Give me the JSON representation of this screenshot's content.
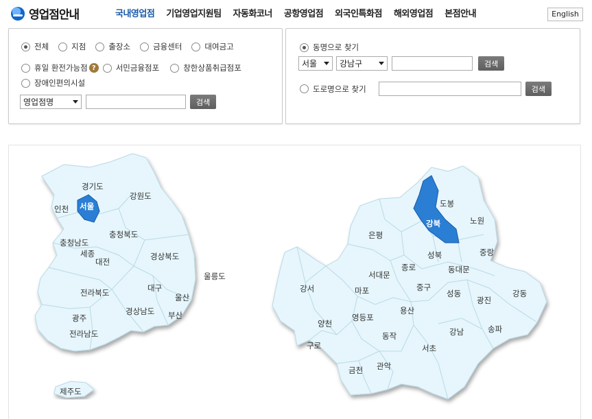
{
  "header": {
    "logo_text": "영업점안내",
    "nav": [
      "국내영업점",
      "기업영업지원팀",
      "자동화코너",
      "공항영업점",
      "외국인특화점",
      "해외영업점",
      "본점안내"
    ],
    "lang_button": "English"
  },
  "left_panel": {
    "type_options": [
      "전체",
      "지점",
      "출장소",
      "금융센터",
      "대여금고"
    ],
    "type_options_row2": [
      "휴일 환전가능점",
      "서민금융점포",
      "창한상품취급점포"
    ],
    "type_options_row3": [
      "장애인편의시설"
    ],
    "selected_type": "전체",
    "search_select": "영업점명",
    "search_button": "검색"
  },
  "right_panel": {
    "dong_label": "동명으로 찾기",
    "city_select": "서울",
    "district_select": "강남구",
    "dong_button": "검색",
    "road_label": "도로명으로 찾기",
    "road_button": "검색"
  },
  "korea_map": {
    "selected": "서울",
    "regions": [
      "경기도",
      "인천",
      "서울",
      "강원도",
      "충청북도",
      "충청남도",
      "세종",
      "대전",
      "경상북도",
      "울릉도",
      "전라북도",
      "대구",
      "울산",
      "광주",
      "경상남도",
      "부산",
      "전라남도",
      "제주도"
    ]
  },
  "seoul_map": {
    "selected": "강북",
    "districts": [
      "도봉",
      "강북",
      "노원",
      "은평",
      "성북",
      "중랑",
      "종로",
      "동대문",
      "서대문",
      "강서",
      "마포",
      "중구",
      "성동",
      "광진",
      "강동",
      "용산",
      "양천",
      "영등포",
      "동작",
      "강남",
      "송파",
      "구로",
      "서초",
      "금천",
      "관악"
    ]
  },
  "colors": {
    "region_fill": "#e6f6fc",
    "region_selected": "#2a7fd4",
    "border": "#c9c9c9",
    "nav_active": "#1a5aa8"
  }
}
